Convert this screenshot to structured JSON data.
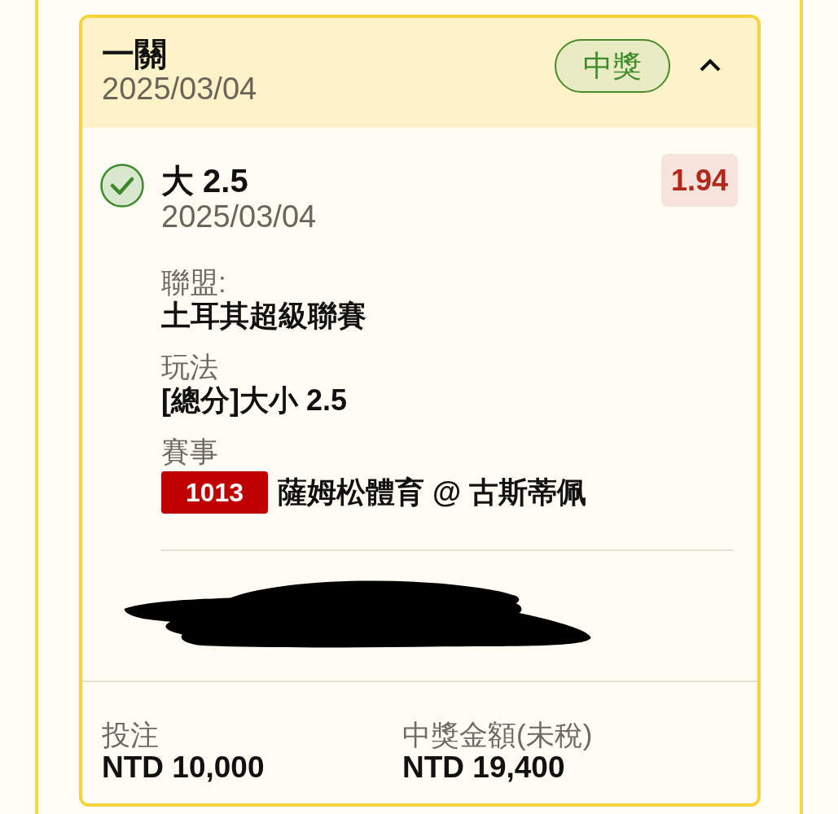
{
  "card": {
    "title": "一關",
    "date": "2025/03/04",
    "status": {
      "label": "中獎",
      "kind": "won"
    },
    "expanded": true
  },
  "selections": [
    {
      "won": true,
      "pick": "大 2.5",
      "date": "2025/03/04",
      "odds": "1.94",
      "fields": [
        {
          "kind": "text",
          "label": "聯盟:",
          "value": "土耳其超級聯賽"
        },
        {
          "kind": "text",
          "label": "玩法",
          "value": "[總分]大小 2.5"
        },
        {
          "kind": "match",
          "label": "賽事",
          "match_code": "1013",
          "value": "薩姆松體育 @ 古斯蒂佩"
        }
      ]
    }
  ],
  "details_redacted": true,
  "summary": [
    {
      "label": "投注",
      "value": "NTD 10,000"
    },
    {
      "label": "中獎金額(未稅)",
      "value": "NTD 19,400"
    }
  ]
}
